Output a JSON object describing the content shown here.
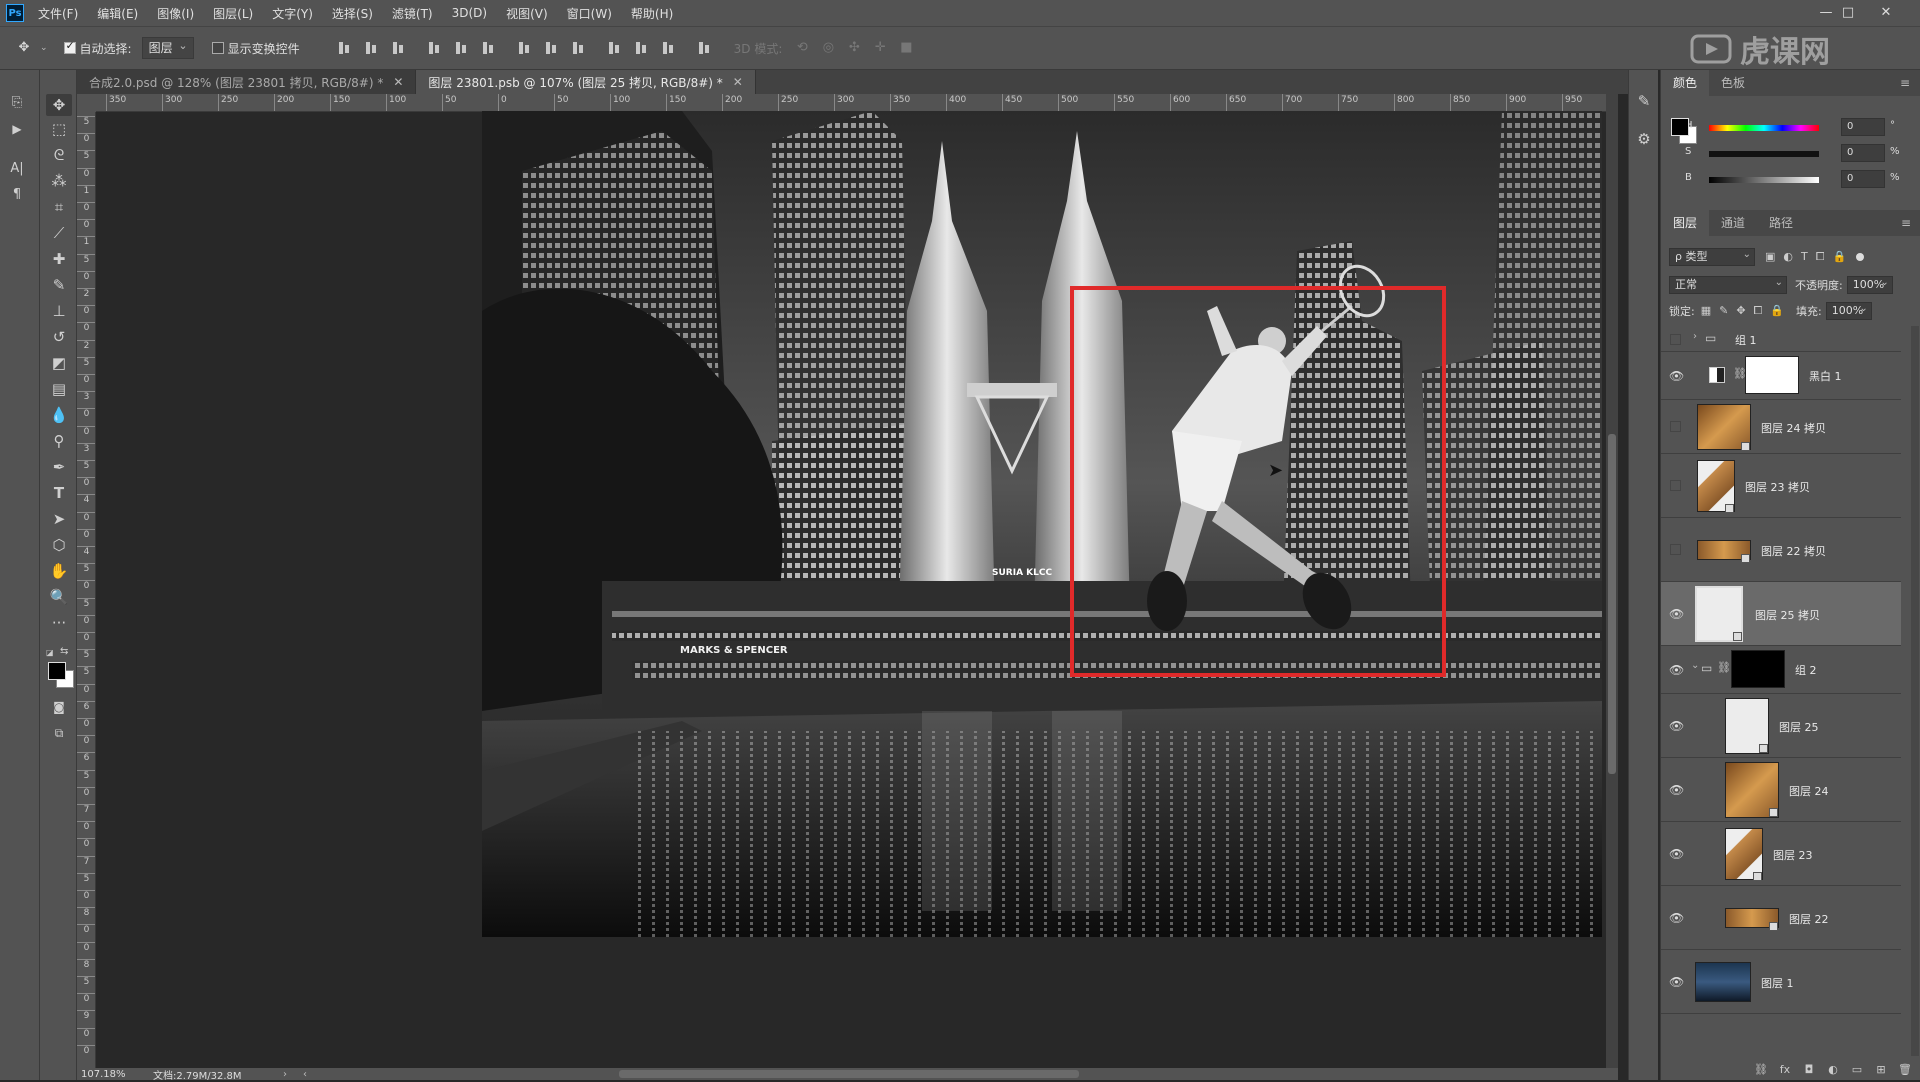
{
  "menubar": {
    "items": [
      "文件(F)",
      "编辑(E)",
      "图像(I)",
      "图层(L)",
      "文字(Y)",
      "选择(S)",
      "滤镜(T)",
      "3D(D)",
      "视图(V)",
      "窗口(W)",
      "帮助(H)"
    ]
  },
  "options": {
    "auto_select_label": "自动选择:",
    "auto_select_target": "图层",
    "show_transform_label": "显示变换控件",
    "mode_3d_label": "3D 模式:"
  },
  "tabs": [
    {
      "label": "合成2.0.psd @ 128% (图层 23801 拷贝, RGB/8#) *",
      "active": false
    },
    {
      "label": "图层 23801.psb @ 107% (图层 25 拷贝, RGB/8#) *",
      "active": true
    }
  ],
  "ruler_h": [
    "350",
    "300",
    "250",
    "200",
    "150",
    "100",
    "50",
    "0",
    "50",
    "100",
    "150",
    "200",
    "250",
    "300",
    "350",
    "400",
    "450",
    "500",
    "550",
    "600",
    "650",
    "700",
    "750",
    "800",
    "850",
    "900",
    "950"
  ],
  "ruler_v": [
    "5",
    "0",
    "5",
    "0",
    "1",
    "0",
    "0",
    "1",
    "5",
    "0",
    "2",
    "0",
    "0",
    "2",
    "5",
    "0",
    "3",
    "0",
    "0",
    "3",
    "5",
    "0",
    "4",
    "0",
    "0",
    "4",
    "5",
    "0",
    "5",
    "0",
    "0",
    "5",
    "5",
    "0",
    "6",
    "0",
    "0",
    "6",
    "5",
    "0",
    "7",
    "0",
    "0",
    "7",
    "5",
    "0",
    "8",
    "0",
    "0",
    "8",
    "5",
    "0",
    "9",
    "0",
    "0"
  ],
  "canvas": {
    "photo_text": "SURIA KLCC",
    "sign_text": "MARKS & SPENCER"
  },
  "status": {
    "zoom": "107.18%",
    "doc_info": "文档:2.79M/32.8M"
  },
  "watermark": "虎课网",
  "color_panel": {
    "tabs": [
      "颜色",
      "色板"
    ],
    "sliders": [
      {
        "label": "H",
        "value": "0",
        "unit": "°"
      },
      {
        "label": "S",
        "value": "0",
        "unit": "%"
      },
      {
        "label": "B",
        "value": "0",
        "unit": "%"
      }
    ]
  },
  "layers_panel": {
    "tabs": [
      "图层",
      "通道",
      "路径"
    ],
    "filter_label": "ρ 类型",
    "blend_mode": "正常",
    "opacity_label": "不透明度:",
    "opacity_value": "100%",
    "lock_label": "锁定:",
    "fill_label": "填充:",
    "fill_value": "100%",
    "layers": [
      {
        "name": "组 1",
        "type": "group",
        "visible": false
      },
      {
        "name": "黑白 1",
        "type": "adjustment",
        "visible": true
      },
      {
        "name": "图层 24 拷贝",
        "type": "wood",
        "visible": false
      },
      {
        "name": "图层 23 拷贝",
        "type": "wood",
        "visible": false
      },
      {
        "name": "图层 22 拷贝",
        "type": "wood",
        "visible": false
      },
      {
        "name": "图层 25 拷贝",
        "type": "player",
        "visible": true,
        "selected": true
      },
      {
        "name": "组 2",
        "type": "group",
        "visible": true
      },
      {
        "name": "图层 25",
        "type": "player",
        "visible": true
      },
      {
        "name": "图层 24",
        "type": "wood",
        "visible": true
      },
      {
        "name": "图层 23",
        "type": "wood",
        "visible": true
      },
      {
        "name": "图层 22",
        "type": "wood",
        "visible": true
      },
      {
        "name": "图层 1",
        "type": "photo",
        "visible": true
      }
    ]
  },
  "colors": {
    "selection_rect": "#e02a2a",
    "ui_panel": "#535353"
  }
}
